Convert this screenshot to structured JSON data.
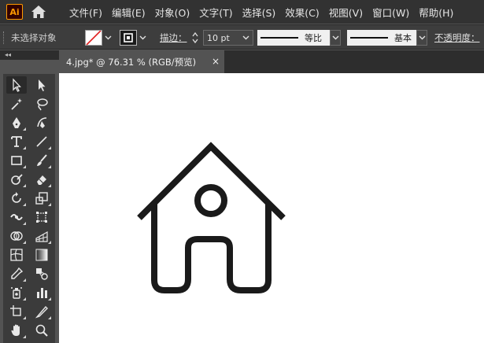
{
  "app": {
    "logo_text": "Ai",
    "brand_color": "#ff9a00"
  },
  "menu": [
    "文件(F)",
    "编辑(E)",
    "对象(O)",
    "文字(T)",
    "选择(S)",
    "效果(C)",
    "视图(V)",
    "窗口(W)",
    "帮助(H)"
  ],
  "control": {
    "selection_status": "未选择对象",
    "stroke_label": "描边：",
    "stroke_weight": "10 pt",
    "profile_label": "等比",
    "brush_label": "基本",
    "opacity_label": "不透明度："
  },
  "document": {
    "tab_title": "4.jpg* @ 76.31 % (RGB/预览)",
    "close_glyph": "×"
  },
  "toolbar": {
    "tools": [
      "selection-icon",
      "direct-selection-icon",
      "magic-wand-icon",
      "lasso-icon",
      "pen-icon",
      "curvature-icon",
      "type-icon",
      "line-segment-icon",
      "rectangle-icon",
      "paintbrush-icon",
      "shaper-icon",
      "eraser-icon",
      "rotate-icon",
      "scale-icon",
      "width-icon",
      "free-transform-icon",
      "shape-builder-icon",
      "perspective-grid-icon",
      "mesh-icon",
      "gradient-icon",
      "eyedropper-icon",
      "blend-icon",
      "symbol-sprayer-icon",
      "column-graph-icon",
      "artboard-icon",
      "slice-icon",
      "hand-icon",
      "zoom-icon"
    ]
  },
  "artwork": {
    "name": "house-outline",
    "stroke_color": "#1a1a1a"
  }
}
